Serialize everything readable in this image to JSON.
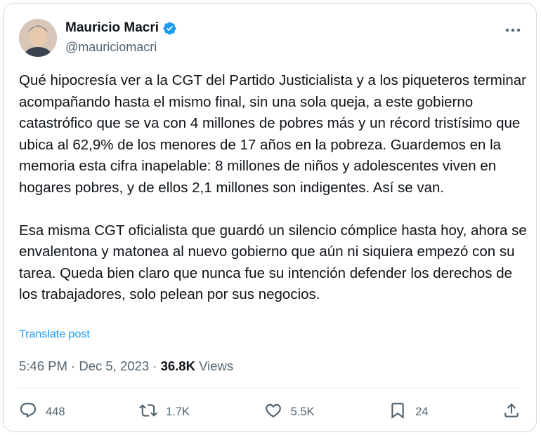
{
  "tweet": {
    "author": {
      "display_name": "Mauricio Macri",
      "handle": "@mauriciomacri",
      "verified": true
    },
    "paragraphs": [
      "Qué hipocresía ver a la CGT del Partido Justicialista y a los piqueteros terminar acompañando hasta el mismo final, sin una sola queja, a este gobierno catastrófico que se va con 4 millones de pobres más y un récord tristísimo que ubica al 62,9% de los menores de 17 años en la pobreza. Guardemos en la memoria esta cifra inapelable: 8 millones de niños y adolescentes viven en hogares pobres, y de ellos 2,1 millones son indigentes. Así se van.",
      "Esa misma CGT oficialista que guardó un silencio cómplice hasta hoy, ahora se envalentona y matonea al nuevo gobierno que aún ni siquiera empezó con su tarea. Queda bien claro que nunca fue su intención defender los derechos de los trabajadores, solo pelean por sus negocios."
    ],
    "translate_label": "Translate post",
    "time": "5:46 PM",
    "separator": "·",
    "date": "Dec 5, 2023",
    "views_count": "36.8K",
    "views_label": "Views",
    "actions": {
      "replies": "448",
      "reposts": "1.7K",
      "likes": "5.5K",
      "bookmarks": "24"
    }
  },
  "colors": {
    "verified_badge": "#1d9bf0",
    "link": "#1d9bf0",
    "secondary_text": "#536471",
    "border": "#cfd9de"
  },
  "icons": [
    "verified-badge-icon",
    "more-icon",
    "reply-icon",
    "repost-icon",
    "like-icon",
    "bookmark-icon",
    "share-icon"
  ]
}
